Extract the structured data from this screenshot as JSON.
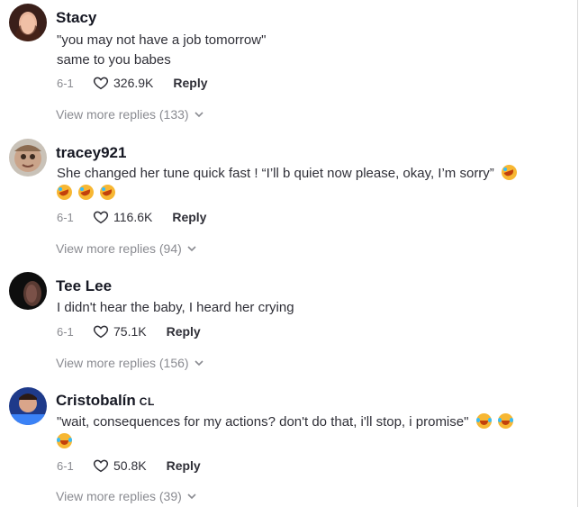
{
  "comments": [
    {
      "username": "Stacy",
      "badge": "",
      "lines": [
        "\"you may not have a job tomorrow\"",
        "same to you babes"
      ],
      "date": "6-1",
      "likes": "326.9K",
      "reply_label": "Reply",
      "more_replies": "View more replies (133)"
    },
    {
      "username": "tracey921",
      "badge": "",
      "lines": [
        "She changed her tune quick fast ! “I’ll b quiet now please, okay, I’m sorry”"
      ],
      "date": "6-1",
      "likes": "116.6K",
      "reply_label": "Reply",
      "more_replies": "View more replies (94)"
    },
    {
      "username": "Tee Lee",
      "badge": "",
      "lines": [
        "I didn't hear the baby, I heard her crying"
      ],
      "date": "6-1",
      "likes": "75.1K",
      "reply_label": "Reply",
      "more_replies": "View more replies (156)"
    },
    {
      "username": "Cristobalín",
      "badge": "CL",
      "lines": [
        "\"wait, consequences for my actions? don't do that, i'll stop, i promise\""
      ],
      "date": "6-1",
      "likes": "50.8K",
      "reply_label": "Reply",
      "more_replies": "View more replies (39)"
    }
  ],
  "icons": {
    "heart": "heart-outline-icon",
    "chevron": "chevron-down-icon",
    "emoji_rofl": "rolling-on-floor-laughing-emoji",
    "emoji_joy": "grinning-squinting-emoji"
  },
  "colors": {
    "username": "#161823",
    "text": "#2f2f37",
    "muted": "#8a8b91",
    "emoji": "#f7b733"
  }
}
